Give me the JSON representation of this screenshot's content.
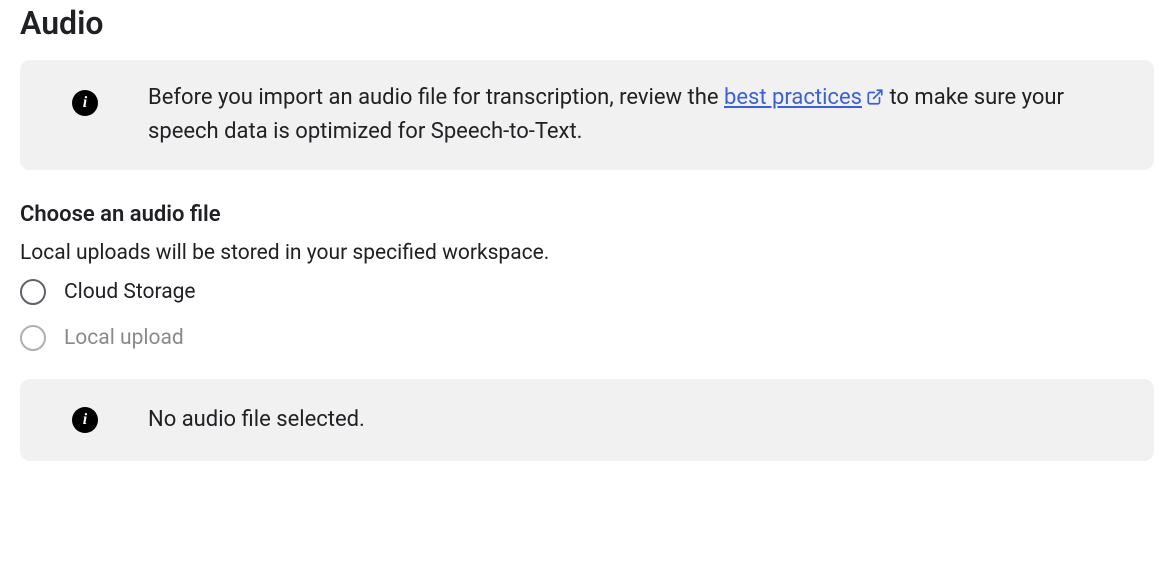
{
  "header": {
    "title": "Audio"
  },
  "notice": {
    "text_before_link": "Before you import an audio file for transcription, review the ",
    "link_text": "best practices",
    "text_after_link": " to make sure your speech data is optimized for Speech-to-Text."
  },
  "choose_section": {
    "heading": "Choose an audio file",
    "hint": "Local uploads will be stored in your specified workspace.",
    "options": {
      "cloud_storage": "Cloud Storage",
      "local_upload": "Local upload"
    }
  },
  "status": {
    "message": "No audio file selected."
  }
}
